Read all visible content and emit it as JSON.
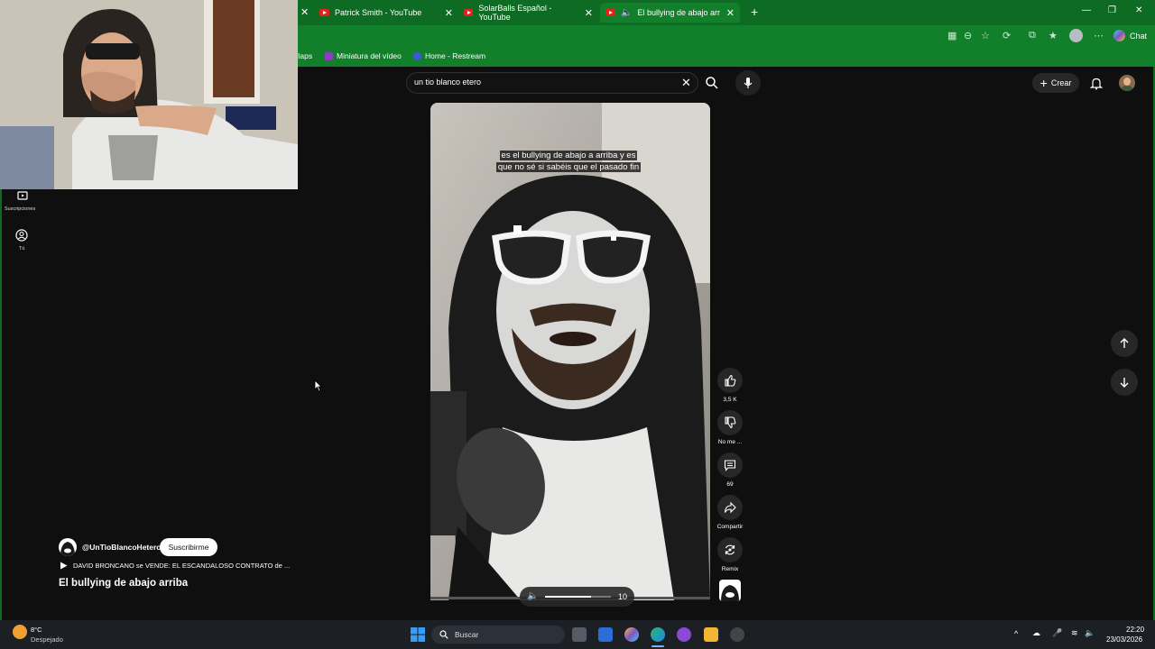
{
  "browser": {
    "tabs": [
      {
        "title": "Patrick Smith - YouTube"
      },
      {
        "title": "SolarBalls Español - YouTube"
      },
      {
        "title": "El bullying de abajo arriba - Y"
      }
    ],
    "bookmarks": [
      {
        "label": "Iaps"
      },
      {
        "label": "Miniatura del vídeo"
      },
      {
        "label": "Home - Restream"
      }
    ],
    "chat_label": "Chat"
  },
  "sidebar": {
    "items": [
      {
        "label": "Suscripciones",
        "icon": "subscriptions-icon"
      },
      {
        "label": "Tú",
        "icon": "you-icon"
      }
    ]
  },
  "search": {
    "value": "un tio blanco etero"
  },
  "header": {
    "create_label": "Crear"
  },
  "video": {
    "caption_line1": "es el bullying de abajo a arriba y es",
    "caption_line2": "que no sé si sabéis que el pasado fin",
    "volume_value": "10",
    "volume_level": 0.7,
    "channel_handle": "@UnTioBlancoHetero",
    "subscribe_label": "Suscribirme",
    "related_video": "DAVID BRONCANO se VENDE: EL ESCANDALOSO CONTRATO de ...",
    "title": "El bullying de abajo arriba"
  },
  "actions": {
    "like_count": "3,5 K",
    "dislike_label": "No me ...",
    "comments_count": "69",
    "share_label": "Compartir",
    "remix_label": "Remix"
  },
  "taskbar": {
    "weather_temp": "8°C",
    "weather_desc": "Despejado",
    "search_placeholder": "Buscar",
    "time": "22:20",
    "date": "23/03/2026"
  },
  "colors": {
    "browser_green": "#12802b",
    "youtube_red": "#e62117",
    "background": "#0f0f0f"
  }
}
